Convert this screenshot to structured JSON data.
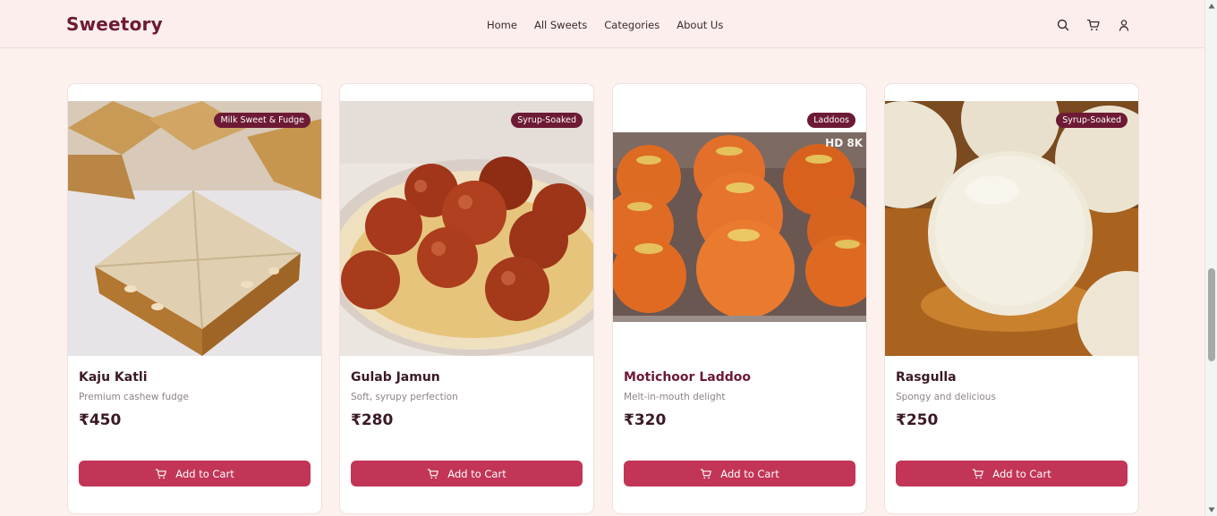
{
  "brand": {
    "name": "Sweetory"
  },
  "nav": {
    "links": [
      "Home",
      "All Sweets",
      "Categories",
      "About Us"
    ],
    "icons": [
      "search-icon",
      "cart-icon",
      "user-icon"
    ]
  },
  "colors": {
    "brand": "#6d1a35",
    "accent": "#c23557",
    "background": "#fdf1ee"
  },
  "products": [
    {
      "name": "Kaju Katli",
      "description": "Premium cashew fudge",
      "price": "₹450",
      "badge": "Milk Sweet & Fudge",
      "button": "Add to Cart"
    },
    {
      "name": "Gulab Jamun",
      "description": "Soft, syrupy perfection",
      "price": "₹280",
      "badge": "Syrup-Soaked",
      "button": "Add to Cart"
    },
    {
      "name": "Motichoor Laddoo",
      "description": "Melt-in-mouth delight",
      "price": "₹320",
      "badge": "Laddoos",
      "image_watermark": "HD 8K",
      "button": "Add to Cart"
    },
    {
      "name": "Rasgulla",
      "description": "Spongy and delicious",
      "price": "₹250",
      "badge": "Syrup-Soaked",
      "button": "Add to Cart"
    }
  ]
}
